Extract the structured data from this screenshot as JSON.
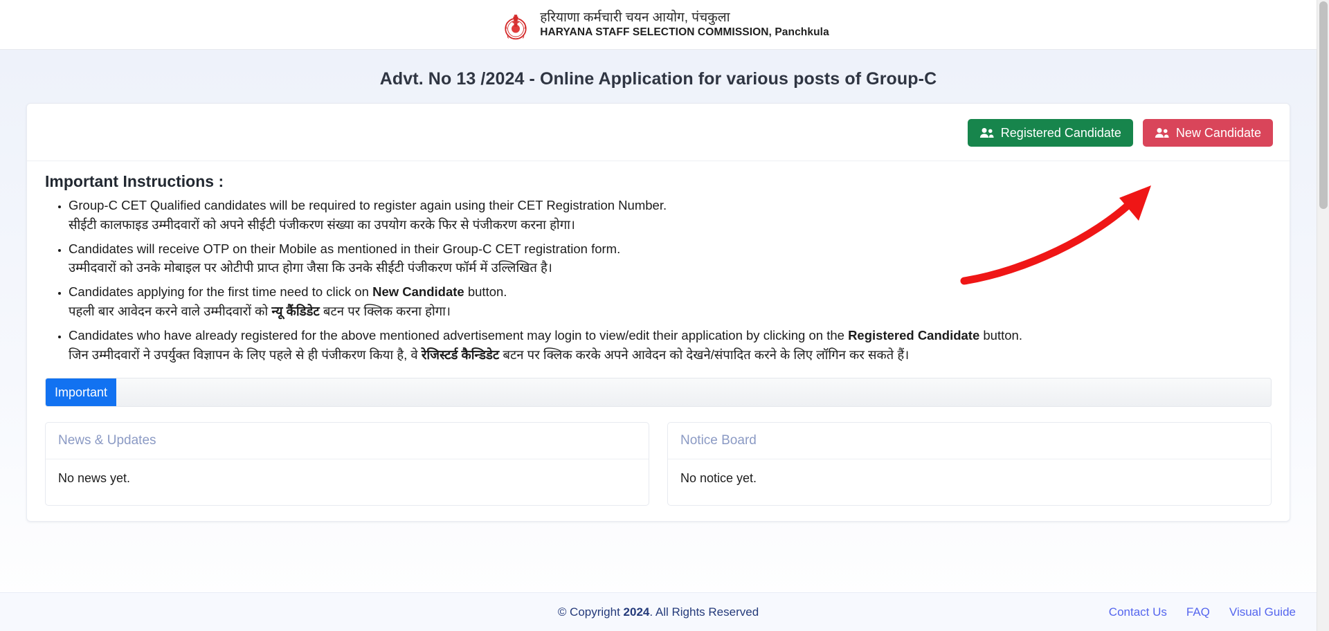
{
  "header": {
    "emblem_icon": "haryana-government-emblem-icon",
    "title_hindi": "हरियाणा कर्मचारी चयन आयोग, पंचकुला",
    "title_english": "HARYANA STAFF SELECTION COMMISSION, Panchkula"
  },
  "page": {
    "title": "Advt. No 13 /2024 - Online Application for various posts of Group-C"
  },
  "actions": {
    "registered_label": "Registered Candidate",
    "new_label": "New Candidate",
    "registered_icon": "users-icon",
    "new_icon": "users-icon",
    "registered_color": "#17854c",
    "new_color": "#d9455a"
  },
  "instructions": {
    "heading": "Important Instructions :",
    "items": [
      {
        "en_pre": "Group-C CET Qualified candidates will be required to register again using their CET Registration Number.",
        "en_bold": "",
        "en_post": "",
        "hi_pre": "सीईटी कालफाइड उम्मीदवारों को अपने सीईटी पंजीकरण संख्या का उपयोग करके फिर से पंजीकरण करना होगा।",
        "hi_bold": "",
        "hi_post": ""
      },
      {
        "en_pre": "Candidates will receive OTP on their Mobile as mentioned in their Group-C CET registration form.",
        "en_bold": "",
        "en_post": "",
        "hi_pre": "उम्मीदवारों को उनके मोबाइल पर ओटीपी प्राप्त होगा जैसा कि उनके सीईटी पंजीकरण फॉर्म में उल्लिखित है।",
        "hi_bold": "",
        "hi_post": ""
      },
      {
        "en_pre": "Candidates applying for the first time need to click on ",
        "en_bold": "New Candidate",
        "en_post": " button.",
        "hi_pre": "पहली बार आवेदन करने वाले उम्मीदवारों को ",
        "hi_bold": "न्यू कैंडिडेट",
        "hi_post": " बटन पर क्लिक करना होगा।"
      },
      {
        "en_pre": "Candidates who have already registered for the above mentioned advertisement may login to view/edit their application by clicking on the ",
        "en_bold": "Registered Candidate",
        "en_post": " button.",
        "hi_pre": "जिन उम्मीदवारों ने उपर्युक्त विज्ञापन के लिए पहले से ही पंजीकरण किया है, वे ",
        "hi_bold": "रेजिस्टर्ड कैन्डिडेट",
        "hi_post": " बटन पर क्लिक करके अपने आवेदन को देखने/संपादित करने के लिए लॉगिन कर सकते हैं।"
      }
    ]
  },
  "tabs": {
    "active_label": "Important",
    "active_color": "#1272f1"
  },
  "panels": [
    {
      "title": "News & Updates",
      "body": "No news yet."
    },
    {
      "title": "Notice Board",
      "body": "No notice yet."
    }
  ],
  "footer": {
    "copyright_pre": "© Copyright ",
    "copyright_year": "2024",
    "copyright_post": ". All Rights Reserved",
    "links": [
      "Contact Us",
      "FAQ",
      "Visual Guide"
    ]
  },
  "annotation": {
    "arrow_color": "#ef1616",
    "arrow_target": "new-candidate-button"
  }
}
